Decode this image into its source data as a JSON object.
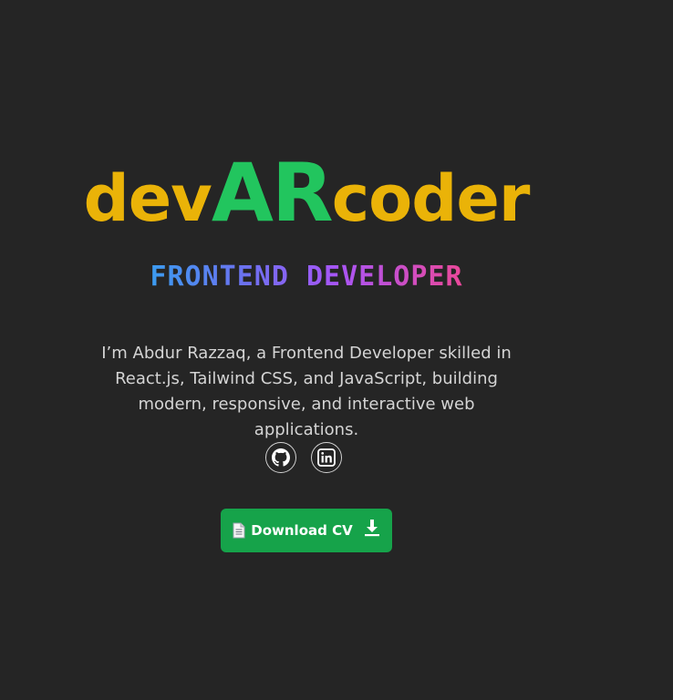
{
  "logo": {
    "part1": "dev",
    "part2": "AR",
    "part3": "coder",
    "color_primary": "#eab308",
    "color_accent": "#22c55e"
  },
  "role": {
    "text": "FRONTEND DEVELOPER",
    "gradient": [
      "#3b9cf0",
      "#a855f7",
      "#ec4899"
    ]
  },
  "bio": {
    "text": "I’m Abdur Razzaq, a Frontend Developer skilled in React.js, Tailwind CSS, and JavaScript, building modern, responsive, and interactive web applications."
  },
  "socials": [
    {
      "name": "github",
      "icon": "github-icon"
    },
    {
      "name": "linkedin",
      "icon": "linkedin-icon"
    }
  ],
  "download": {
    "label": "Download CV",
    "doc_icon": "document-icon",
    "action_icon": "download-icon",
    "color": "#16a34a"
  },
  "theme": {
    "background": "#252525",
    "text": "#d4d4d4"
  }
}
